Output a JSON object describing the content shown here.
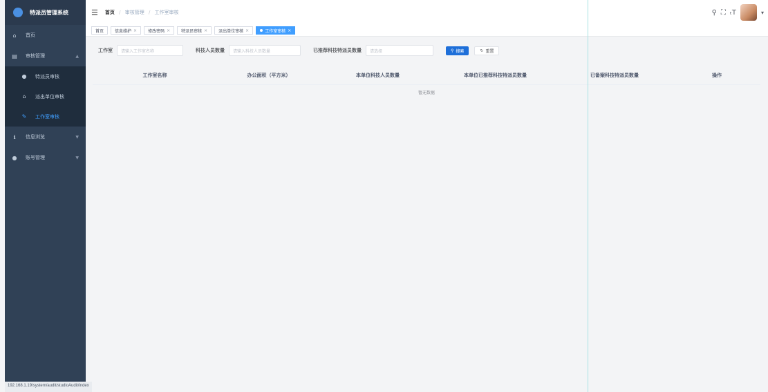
{
  "app": {
    "title": "特派员管理系统"
  },
  "sidebar": {
    "items": [
      {
        "icon": "home-icon",
        "label": "首页"
      },
      {
        "icon": "audit-icon",
        "label": "审核管理"
      }
    ],
    "sub_items": [
      {
        "icon": "user-icon",
        "label": "特派员审核"
      },
      {
        "icon": "building-icon",
        "label": "派出单位审核"
      },
      {
        "icon": "edit-icon",
        "label": "工作室审核"
      }
    ],
    "bottom_items": [
      {
        "icon": "info-icon",
        "label": "信息浏览"
      },
      {
        "icon": "account-icon",
        "label": "账号管理"
      }
    ]
  },
  "breadcrumb": {
    "home": "首页",
    "level2": "审核管理",
    "current": "工作室审核"
  },
  "tags": [
    "首页",
    "信息维护",
    "修改密码",
    "特派员审核",
    "派出单位审核",
    "工作室审核"
  ],
  "search": {
    "studio_label": "工作室",
    "studio_placeholder": "请输入工作室名称",
    "staff_label": "科技人员数量",
    "staff_placeholder": "请输入科技人员数量",
    "recommended_label": "已推荐科技特派员数量",
    "recommended_placeholder": "请选择",
    "search_button": "搜索",
    "reset_button": "重置"
  },
  "table": {
    "columns": [
      "工作室名称",
      "办公面积（平方米）",
      "本单位科技人员数量",
      "本单位已推荐科技特派员数量",
      "已备案科技特派员数量",
      "操作"
    ],
    "rows": [],
    "empty_text": "暂无数据"
  },
  "status_bar": {
    "url": "192.168.1.19/system/audit/studioAudit/index"
  },
  "colors": {
    "sidebar_bg": "#304156",
    "accent": "#409eff",
    "button_primary": "#1e6fd9"
  }
}
